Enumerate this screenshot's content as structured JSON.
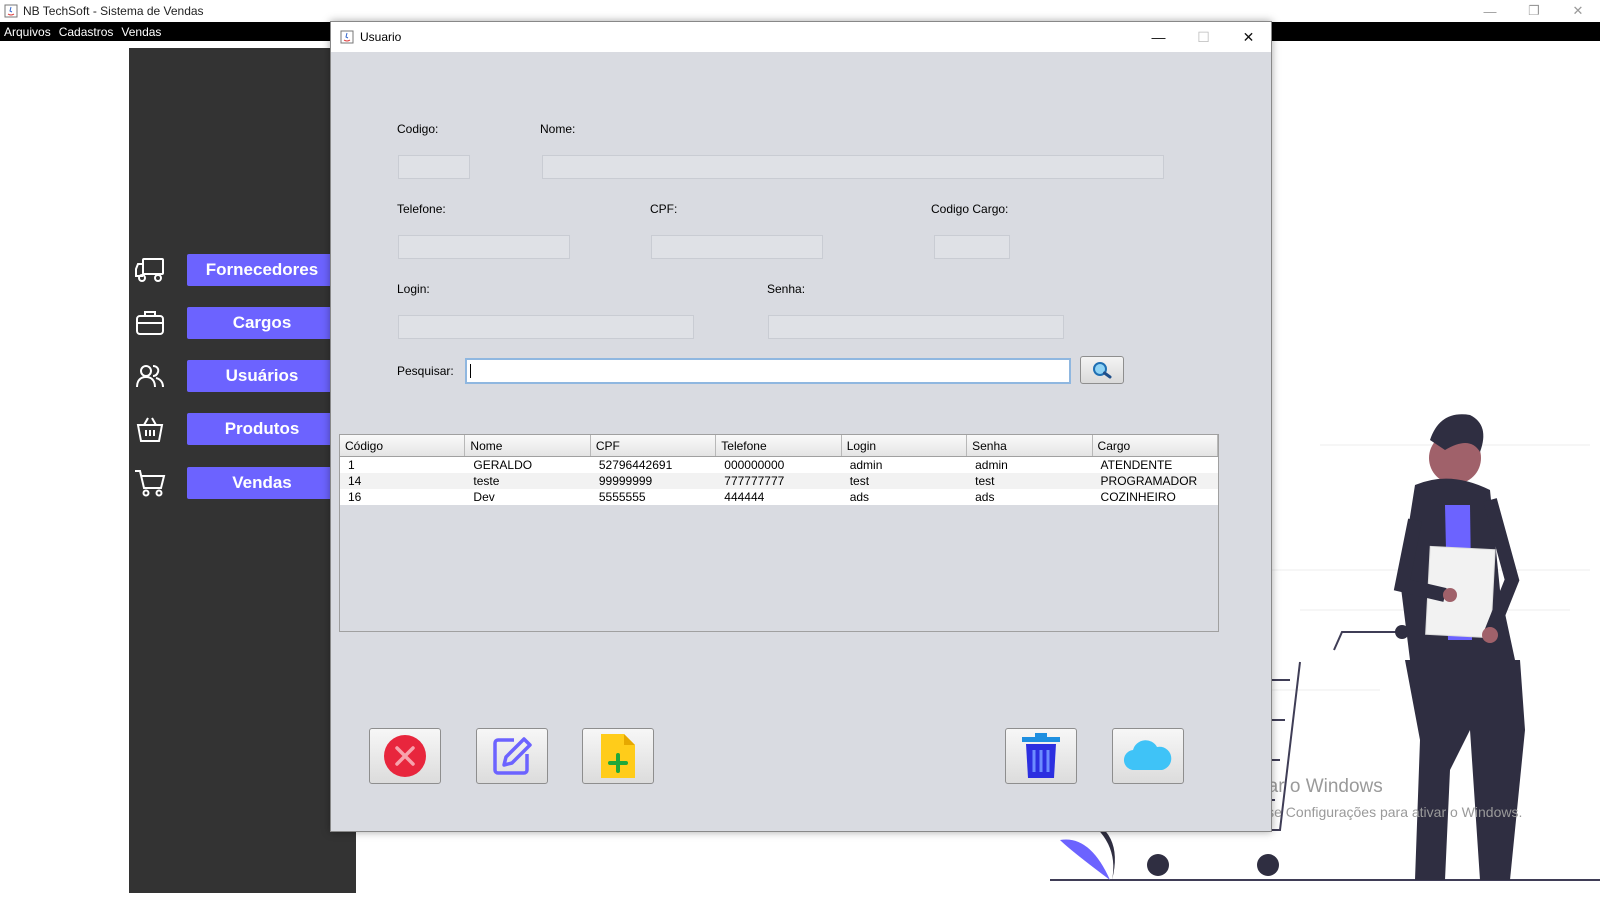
{
  "app": {
    "title": "NB TechSoft - Sistema de Vendas",
    "menu": [
      "Arquivos",
      "Cadastros",
      "Vendas"
    ],
    "window_controls": {
      "minimize": "—",
      "maximize": "❐",
      "close": "✕"
    }
  },
  "sidebar": {
    "items": [
      {
        "label": "Fornecedores",
        "icon": "truck-icon"
      },
      {
        "label": "Cargos",
        "icon": "briefcase-icon"
      },
      {
        "label": "Usuários",
        "icon": "users-icon"
      },
      {
        "label": "Produtos",
        "icon": "basket-icon"
      },
      {
        "label": "Vendas",
        "icon": "cart-icon"
      }
    ]
  },
  "dialog": {
    "title": "Usuario",
    "controls": {
      "minimize": "—",
      "maximize": "☐",
      "close": "✕"
    },
    "labels": {
      "codigo": "Codigo:",
      "nome": "Nome:",
      "telefone": "Telefone:",
      "cpf": "CPF:",
      "codigo_cargo": "Codigo Cargo:",
      "login": "Login:",
      "senha": "Senha:",
      "pesquisar": "Pesquisar:"
    },
    "fields": {
      "codigo": "",
      "nome": "",
      "telefone": "",
      "cpf": "",
      "codigo_cargo": "",
      "login": "",
      "senha": "",
      "pesquisar": ""
    },
    "table": {
      "columns": [
        "Código",
        "Nome",
        "CPF",
        "Telefone",
        "Login",
        "Senha",
        "Cargo"
      ],
      "rows": [
        [
          "1",
          "GERALDO",
          "52796442691",
          "000000000",
          "admin",
          "admin",
          "ATENDENTE"
        ],
        [
          "14",
          "teste",
          "99999999",
          "777777777",
          "test",
          "test",
          "PROGRAMADOR"
        ],
        [
          "16",
          "Dev",
          "5555555",
          "444444",
          "ads",
          "ads",
          "COZINHEIRO"
        ]
      ]
    },
    "buttons": {
      "cancel": "cancel-icon",
      "edit": "edit-icon",
      "new": "new-file-icon",
      "delete": "trash-icon",
      "save": "cloud-icon"
    }
  },
  "watermark": {
    "line1": "Ativar o Windows",
    "line2": "Acesse Configurações para ativar o Windows."
  },
  "colors": {
    "accent": "#6c63ff",
    "sidebar_bg": "#333333",
    "dialog_bg": "#d9dbe1"
  }
}
